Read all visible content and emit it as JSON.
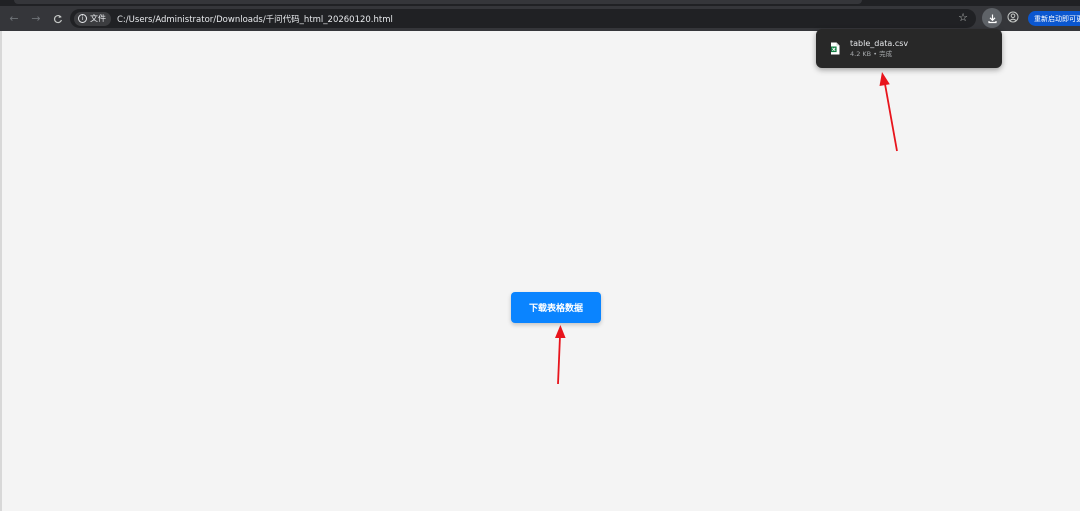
{
  "browser": {
    "info_chip_label": "文件",
    "url": "C:/Users/Administrator/Downloads/千问代码_html_20260120.html",
    "restart_label": "重新启动即可更新",
    "accent_color": "#0b57d0"
  },
  "download_popup": {
    "file_name": "table_data.csv",
    "status": "4.2 KB • 完成",
    "file_icon": "excel-csv-file-icon"
  },
  "page": {
    "download_button_label": "下载表格数据",
    "button_color": "#0a84ff"
  },
  "annotations": {
    "arrow_color": "#e8141c",
    "arrows": [
      "arrow-to-download-button",
      "arrow-to-download-popup"
    ]
  }
}
